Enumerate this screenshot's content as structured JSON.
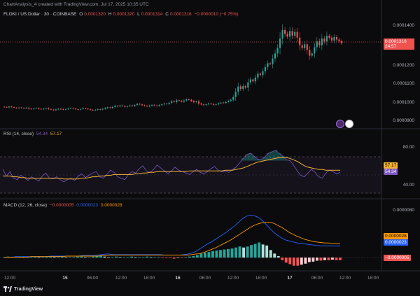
{
  "header": {
    "text": "ChartAnalysis_4 created with TradingView.com, Jul 17, 2025 10:35 UTC"
  },
  "price_legend": {
    "symbol": "FLOKI / US Dollar · 30 · COINBASE",
    "o_label": "O",
    "o_val": "0.0001320",
    "h_label": "H",
    "h_val": "0.0001320",
    "l_label": "L",
    "l_val": "0.0001314",
    "c_label": "C",
    "c_val": "0.0001316",
    "change": "−0.0000010 (−0.75%)"
  },
  "price_axis": [
    "0.0001400",
    "0.0001200",
    "0.0001100",
    "0.0001000",
    "0.0000900"
  ],
  "price_badge": {
    "price": "0.0001316",
    "timer": "24:57"
  },
  "rsi_legend": {
    "name": "RSI (14, close)",
    "rsi": "54.34",
    "ma": "57.17"
  },
  "rsi_axis": [
    "80.00",
    "40.00"
  ],
  "rsi_badges": {
    "ma": "57.17",
    "rsi": "54.34"
  },
  "macd_legend": {
    "name": "MACD (12, 26, close)",
    "hist": "−0.0000005",
    "macd": "0.0000023",
    "signal": "0.0000028"
  },
  "macd_axis": [
    "0.0000080"
  ],
  "macd_badges": {
    "signal": "0.0000028",
    "macd": "0.0000023",
    "hist": "−0.0000005"
  },
  "time_axis": [
    {
      "label": "12:00",
      "bold": false
    },
    {
      "label": "15",
      "bold": true
    },
    {
      "label": "06:00",
      "bold": false
    },
    {
      "label": "12:00",
      "bold": false
    },
    {
      "label": "18:00",
      "bold": false
    },
    {
      "label": "16",
      "bold": true
    },
    {
      "label": "06:00",
      "bold": false
    },
    {
      "label": "12:00",
      "bold": false
    },
    {
      "label": "18:00",
      "bold": false
    },
    {
      "label": "17",
      "bold": true
    },
    {
      "label": "06:00",
      "bold": false
    },
    {
      "label": "12:00",
      "bold": false
    },
    {
      "label": "18:00",
      "bold": false
    }
  ],
  "footer": {
    "brand": "TradingView"
  },
  "colors": {
    "up": "#26a69a",
    "down": "#ef5350",
    "rsi": "#7e57c2",
    "rsi_ma": "#f2b134",
    "macd": "#2962ff",
    "signal": "#ff9800"
  },
  "chart_data": [
    {
      "type": "candlestick",
      "title": "FLOKI / US Dollar · 30 · COINBASE",
      "ylim": [
        8.8e-05,
        0.000144
      ],
      "closes": [
        9.8e-05,
        9.78e-05,
        9.82e-05,
        9.79e-05,
        9.76e-05,
        9.74e-05,
        9.77e-05,
        9.75e-05,
        9.73e-05,
        9.76e-05,
        9.71e-05,
        9.69e-05,
        9.72e-05,
        9.74e-05,
        9.7e-05,
        9.68e-05,
        9.71e-05,
        9.73e-05,
        9.69e-05,
        9.66e-05,
        9.63e-05,
        9.67e-05,
        9.7e-05,
        9.68e-05,
        9.66e-05,
        9.69e-05,
        9.72e-05,
        9.74e-05,
        9.71e-05,
        9.68e-05,
        9.66e-05,
        9.69e-05,
        9.73e-05,
        9.71e-05,
        9.68e-05,
        9.65e-05,
        9.62e-05,
        9.65e-05,
        9.68e-05,
        9.66e-05,
        9.7e-05,
        9.74e-05,
        9.78e-05,
        9.75e-05,
        9.8e-05,
        9.86e-05,
        9.83e-05,
        9.88e-05,
        9.85e-05,
        9.81e-05,
        9.84e-05,
        9.88e-05,
        9.85e-05,
        9.9e-05,
        9.96e-05,
        9.93e-05,
        9.89e-05,
        9.86e-05,
        9.83e-05,
        9.87e-05,
        9.91e-05,
        9.88e-05,
        9.86e-05,
        9.9e-05,
        9.94e-05,
        9.98e-05,
        9.96e-05,
        0.0001002,
        0.000101,
        0.0001006,
        0.0001015,
        0.0001012,
        0.0001008,
        0.0001014,
        0.000102,
        0.0001017,
        0.0001011,
        0.0001005,
        0.0001009,
        9.98e-05,
        9.93e-05,
        9.9e-05,
        9.94e-05,
        9.98e-05,
        9.95e-05,
        9.91e-05,
        9.94e-05,
        9.99e-05,
        0.0001003,
        0.0001001,
        0.0001006,
        0.0001012,
        0.0001018,
        0.0001032,
        0.000106,
        0.0001088,
        0.0001075,
        0.000109,
        0.0001082,
        0.000111,
        0.0001125,
        0.0001115,
        0.0001135,
        0.0001155,
        0.0001148,
        0.0001168,
        0.000119,
        0.000121,
        0.0001205,
        0.0001235,
        0.0001262,
        0.000129,
        0.000134,
        0.0001385,
        0.0001365,
        0.000135,
        0.000138,
        0.0001355,
        0.0001375,
        0.0001345,
        0.0001305,
        0.000129,
        0.000131,
        0.000128,
        0.000125,
        0.0001262,
        0.0001295,
        0.0001325,
        0.0001305,
        0.000134,
        0.0001325,
        0.0001355,
        0.0001345,
        0.000133,
        0.0001348,
        0.0001335,
        0.0001326,
        0.0001316
      ]
    },
    {
      "type": "line",
      "title": "RSI (14, close)",
      "ylim": [
        20,
        100
      ],
      "bands": [
        30,
        70
      ],
      "series": [
        {
          "name": "RSI",
          "values": [
            58,
            49,
            55,
            46,
            44,
            50,
            47,
            43,
            48,
            45,
            42,
            49,
            53,
            46,
            45,
            48,
            44,
            41,
            44,
            46,
            43,
            49,
            52,
            47,
            50,
            53,
            55,
            48,
            46,
            51,
            57,
            54,
            48,
            46,
            44,
            51,
            55,
            53,
            59,
            63,
            56,
            54,
            58,
            64,
            60,
            56,
            52,
            56,
            61,
            57,
            55,
            53,
            51,
            55,
            58,
            54,
            52,
            55,
            59,
            62,
            57,
            55,
            56,
            54,
            58,
            61,
            67,
            73,
            78,
            80,
            76,
            72,
            71,
            75,
            80,
            82,
            84,
            80,
            76,
            71,
            70,
            64,
            56,
            50,
            48,
            53,
            58,
            54,
            48,
            46,
            53,
            57,
            55,
            52,
            54
          ]
        },
        {
          "name": "RSI MA",
          "values": [
            49,
            49,
            49,
            48,
            48,
            47,
            47,
            46,
            46,
            46,
            46,
            46,
            46,
            46,
            46,
            46,
            46,
            45,
            45,
            45,
            45,
            45,
            46,
            46,
            47,
            48,
            48,
            49,
            49,
            50,
            50,
            51,
            51,
            51,
            51,
            51,
            51,
            52,
            52,
            53,
            53,
            54,
            54,
            55,
            55,
            55,
            55,
            55,
            55,
            55,
            55,
            55,
            56,
            56,
            56,
            56,
            56,
            56,
            56,
            56,
            56,
            56,
            57,
            57,
            57,
            58,
            59,
            60,
            62,
            64,
            66,
            68,
            69,
            70,
            71,
            72,
            73,
            74,
            74,
            74,
            73,
            71,
            69,
            66,
            63,
            61,
            60,
            59,
            58,
            58,
            57,
            57,
            57,
            57,
            57
          ]
        }
      ]
    },
    {
      "type": "bar+line",
      "title": "MACD (12, 26, close)",
      "ylim": [
        -2.2e-06,
        1e-05
      ],
      "series": [
        {
          "name": "Histogram",
          "values": [
            1e-07,
            2e-07,
            1e-07,
            1e-07,
            2e-07,
            1e-07,
            1e-07,
            1e-07,
            2e-07,
            1e-07,
            1e-07,
            2e-07,
            2e-07,
            1e-07,
            1e-07,
            2e-07,
            1e-07,
            1e-07,
            1e-07,
            2e-07,
            2e-07,
            1e-07,
            1e-07,
            2e-07,
            3e-07,
            4e-07,
            2e-07,
            1e-07,
            1e-07,
            2e-07,
            1e-07,
            1e-07,
            1e-07,
            2e-07,
            1e-07,
            1e-07,
            1e-07,
            2e-07,
            1e-07,
            1e-07,
            1e-07,
            -1e-07,
            -1e-07,
            -1e-07,
            -2e-07,
            -1e-07,
            -1e-07,
            1e-07,
            2e-07,
            3e-07,
            5e-07,
            8e-07,
            1e-06,
            1.1e-06,
            1.3e-06,
            1.4e-06,
            1.5e-06,
            1.6e-06,
            1.7e-06,
            1.8e-06,
            2e-06,
            2.2e-06,
            2e-06,
            2.2e-06,
            2.5e-06,
            2.7e-06,
            3e-06,
            2.6e-06,
            2.4e-06,
            1.5e-06,
            8e-07,
            3e-07,
            -5e-07,
            -1e-06,
            -1.3e-06,
            -1.6e-06,
            -1.6e-06,
            -1.4e-06,
            -1.2e-06,
            -9e-07,
            -8e-07,
            -6e-07,
            -6e-07,
            -5e-07,
            -5e-07,
            -4e-07,
            -5e-07,
            -5e-07
          ]
        },
        {
          "name": "MACD",
          "values": [
            1e-07,
            1e-07,
            1e-07,
            2e-07,
            2e-07,
            2e-07,
            2e-07,
            2e-07,
            2e-07,
            2e-07,
            2e-07,
            2e-07,
            3e-07,
            3e-07,
            3e-07,
            3e-07,
            3e-07,
            3e-07,
            3e-07,
            3e-07,
            4e-07,
            4e-07,
            4e-07,
            4e-07,
            5e-07,
            6e-07,
            7e-07,
            7e-07,
            6e-07,
            6e-07,
            6e-07,
            6e-07,
            6e-07,
            6e-07,
            6e-07,
            6e-07,
            6e-07,
            6e-07,
            6e-07,
            6e-07,
            6e-07,
            5e-07,
            5e-07,
            5e-07,
            5e-07,
            5e-07,
            6e-07,
            7e-07,
            9e-07,
            1.2e-06,
            1.7e-06,
            2.2e-06,
            2.7e-06,
            3.1e-06,
            3.6e-06,
            4.1e-06,
            4.6e-06,
            5.1e-06,
            5.7e-06,
            6.3e-06,
            7e-06,
            7.7e-06,
            8.2e-06,
            8.4e-06,
            8.3e-06,
            8e-06,
            7.4e-06,
            6.6e-06,
            5.8e-06,
            5e-06,
            4.4e-06,
            3.9e-06,
            3.5e-06,
            3.3e-06,
            3.1e-06,
            2.9e-06,
            2.8e-06,
            2.7e-06,
            2.6e-06,
            2.5e-06,
            2.4e-06,
            2.3e-06,
            2.3e-06,
            2.3e-06,
            2.3e-06,
            2.3e-06,
            2.3e-06
          ]
        },
        {
          "name": "Signal",
          "values": [
            1e-07,
            1e-07,
            1e-07,
            1e-07,
            1e-07,
            1e-07,
            1e-07,
            2e-07,
            2e-07,
            2e-07,
            2e-07,
            2e-07,
            2e-07,
            2e-07,
            2e-07,
            2e-07,
            3e-07,
            3e-07,
            3e-07,
            3e-07,
            3e-07,
            3e-07,
            3e-07,
            3e-07,
            3e-07,
            4e-07,
            4e-07,
            5e-07,
            5e-07,
            5e-07,
            5e-07,
            5e-07,
            5e-07,
            5e-07,
            5e-07,
            5e-07,
            5e-07,
            5e-07,
            5e-07,
            5e-07,
            5e-07,
            5e-07,
            5e-07,
            5e-07,
            5e-07,
            5e-07,
            5e-07,
            5e-07,
            6e-07,
            7e-07,
            8e-07,
            1e-06,
            1.3e-06,
            1.6e-06,
            1.9e-06,
            2.3e-06,
            2.7e-06,
            3.1e-06,
            3.5e-06,
            4e-06,
            4.5e-06,
            5e-06,
            5.5e-06,
            6e-06,
            6.4e-06,
            6.7e-06,
            6.9e-06,
            7e-06,
            7e-06,
            6.8e-06,
            6.4e-06,
            6e-06,
            5.5e-06,
            5e-06,
            4.6e-06,
            4.2e-06,
            3.9e-06,
            3.6e-06,
            3.4e-06,
            3.2e-06,
            3.1e-06,
            3e-06,
            2.9e-06,
            2.9e-06,
            2.8e-06,
            2.8e-06,
            2.8e-06
          ]
        }
      ]
    }
  ]
}
